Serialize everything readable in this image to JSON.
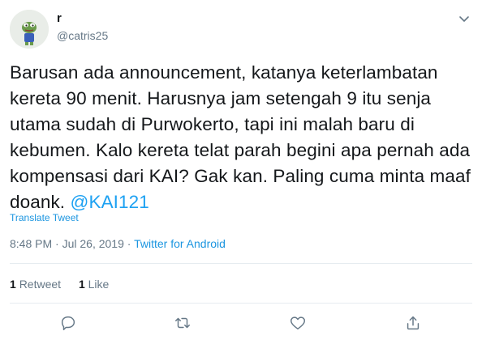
{
  "author": {
    "name": "r",
    "handle": "@catris25",
    "avatar_icon": "pepe-frog-avatar"
  },
  "tweet": {
    "text": "Barusan ada announcement, katanya keterlambatan kereta 90 menit. Harusnya jam setengah 9 itu senja utama sudah di Purwokerto, tapi ini malah baru di kebumen. Kalo kereta telat parah begini apa pernah ada kompensasi dari KAI? Gak kan. Paling cuma minta maaf doank.",
    "mention": "@KAI121",
    "translate_label": "Translate Tweet",
    "time": "8:48 PM",
    "date": "Jul 26, 2019",
    "separator": "·",
    "source": "Twitter for Android"
  },
  "stats": {
    "retweets_count": "1",
    "retweets_label": "Retweet",
    "likes_count": "1",
    "likes_label": "Like"
  },
  "actions": [
    "reply-icon",
    "retweet-icon",
    "like-icon",
    "share-icon"
  ],
  "colors": {
    "accent": "#1da1f2",
    "text": "#14171a",
    "muted": "#657786",
    "border": "#e6ecf0"
  }
}
